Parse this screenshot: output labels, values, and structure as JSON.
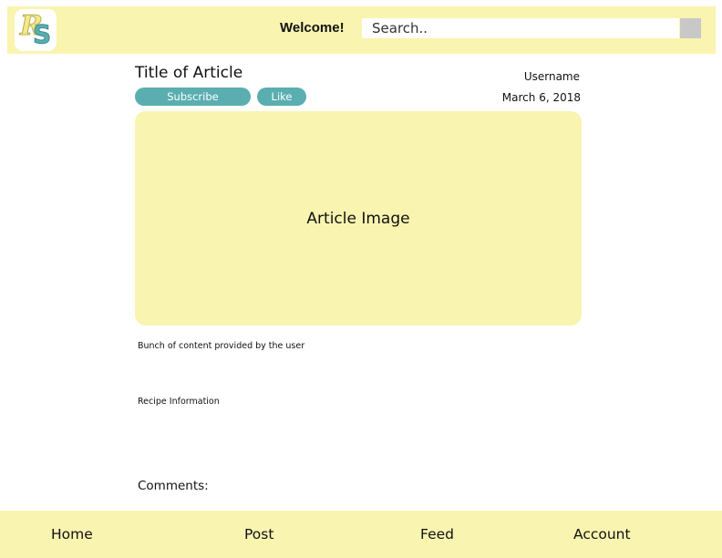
{
  "header": {
    "logo": {
      "letter_1": "R",
      "letter_2": "S"
    },
    "welcome": "Welcome!",
    "search": {
      "placeholder": "Search..",
      "value": ""
    },
    "search_button_icon": "search-button-square"
  },
  "article": {
    "title": "Title of Article",
    "subscribe_label": "Subscribe",
    "like_label": "Like",
    "username": "Username",
    "date": "March 6, 2018",
    "image_label": "Article Image",
    "content": "Bunch of content provided by the user",
    "recipe": "Recipe Information",
    "comments_label": "Comments:"
  },
  "nav": {
    "home": "Home",
    "post": "Post",
    "feed": "Feed",
    "account": "Account"
  },
  "colors": {
    "accent_yellow": "#f9f4b0",
    "accent_teal": "#5aaeb0",
    "search_button": "#c8c8c8"
  }
}
